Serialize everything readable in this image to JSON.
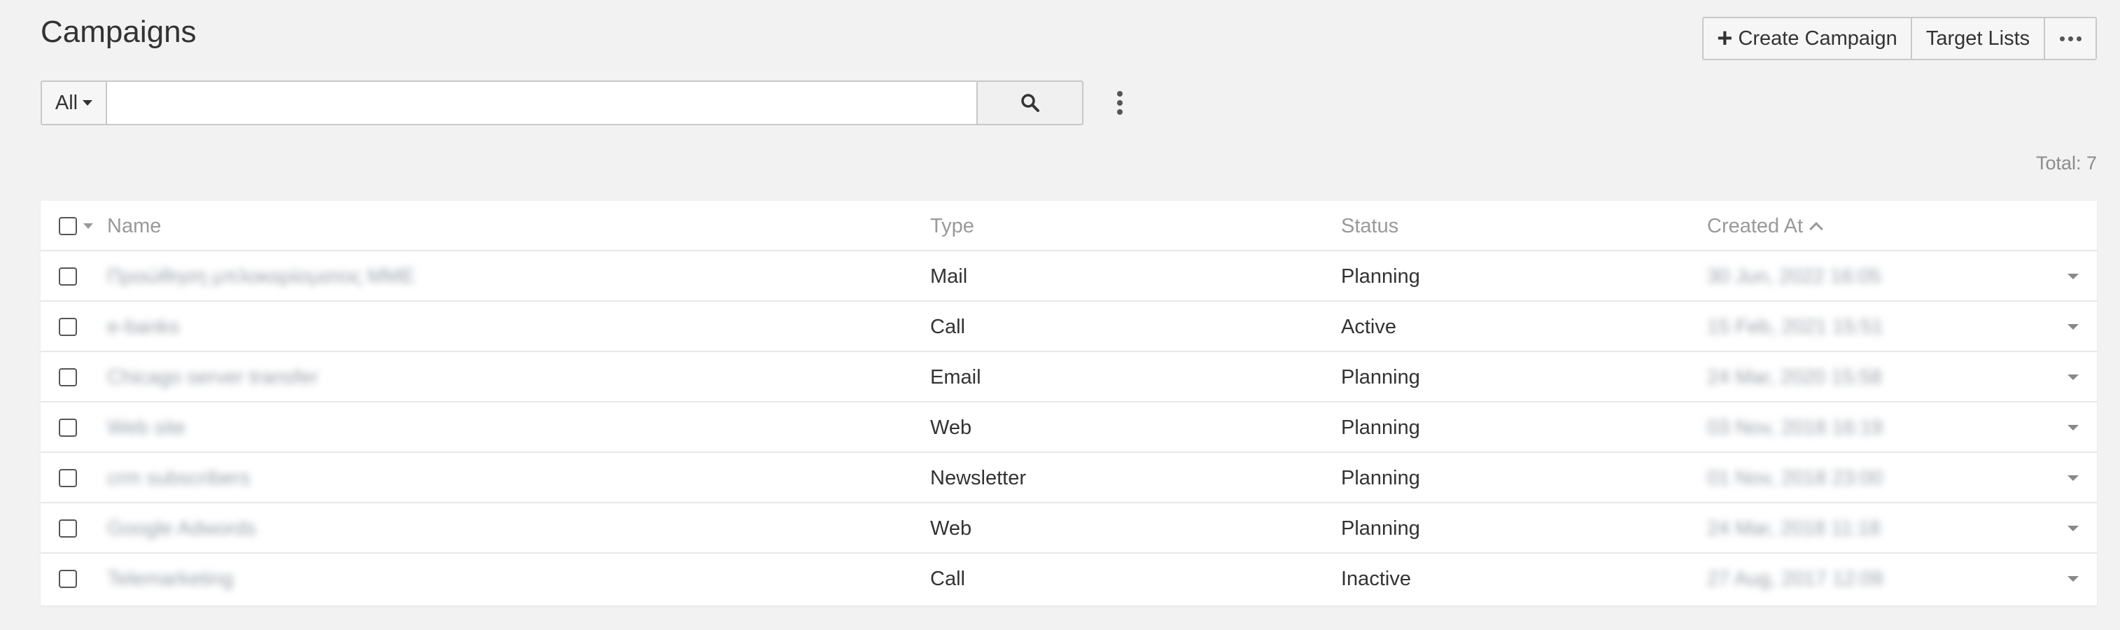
{
  "page": {
    "title": "Campaigns"
  },
  "header_buttons": {
    "create_label": "Create Campaign",
    "target_label": "Target Lists"
  },
  "search": {
    "filter_label": "All",
    "value": "",
    "placeholder": ""
  },
  "summary": {
    "total": "Total: 7"
  },
  "table": {
    "columns": {
      "name": "Name",
      "type": "Type",
      "status": "Status",
      "created_at": "Created At"
    },
    "rows": [
      {
        "name": "Προώθηση μπλοκαρίσματος ΜΜΕ",
        "type": "Mail",
        "status": "Planning",
        "created_at": "30 Jun, 2022 16:05"
      },
      {
        "name": "e-banks",
        "type": "Call",
        "status": "Active",
        "created_at": "15 Feb, 2021 15:51"
      },
      {
        "name": "Chicago server transfer",
        "type": "Email",
        "status": "Planning",
        "created_at": "24 Mar, 2020 15:58"
      },
      {
        "name": "Web site",
        "type": "Web",
        "status": "Planning",
        "created_at": "03 Nov, 2018 16:19"
      },
      {
        "name": "crm subscribers",
        "type": "Newsletter",
        "status": "Planning",
        "created_at": "01 Nov, 2018 23:00"
      },
      {
        "name": "Google Adwords",
        "type": "Web",
        "status": "Planning",
        "created_at": "24 Mar, 2018 11:18"
      },
      {
        "name": "Telemarketing",
        "type": "Call",
        "status": "Inactive",
        "created_at": "27 Aug, 2017 12:09"
      }
    ]
  },
  "icons": {
    "plus": "plus-icon",
    "search": "search-icon",
    "more": "more-horizontal-icon",
    "kebab": "kebab-icon",
    "sort": "sort-ascending-icon"
  }
}
